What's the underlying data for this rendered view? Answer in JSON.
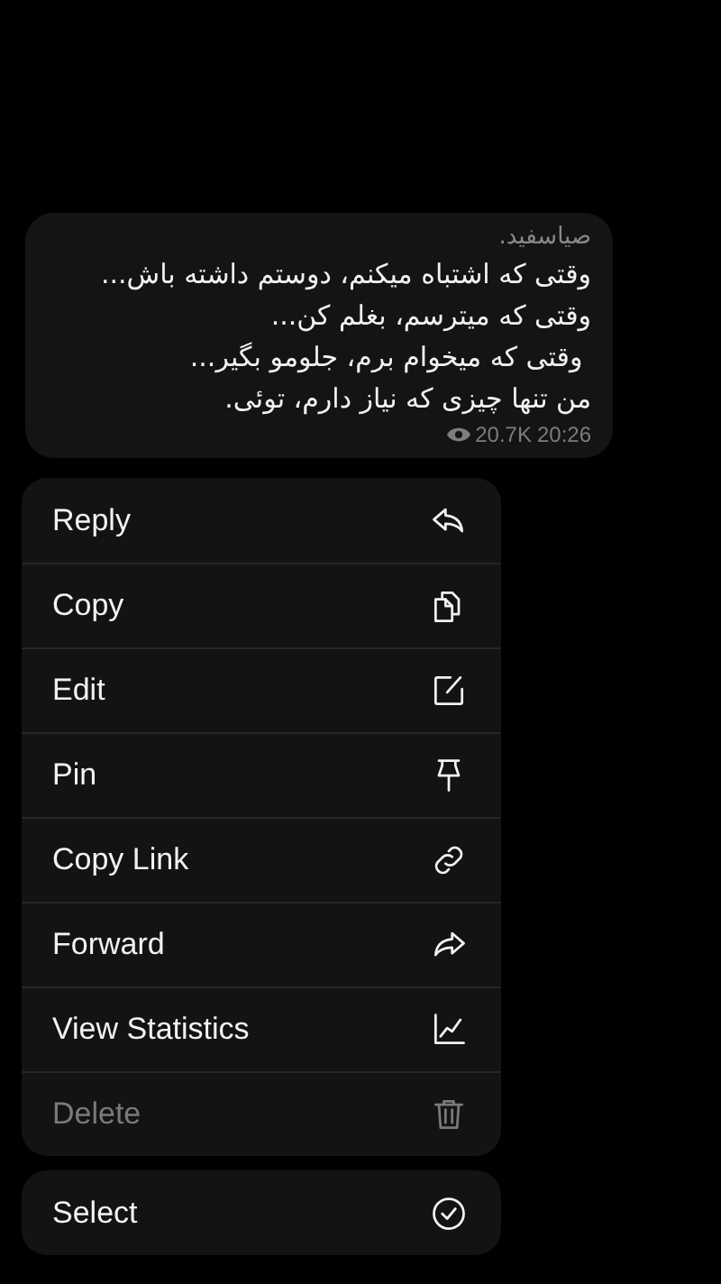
{
  "message": {
    "author": "صیاسفید.",
    "lines": [
      "وقتی که اشتباه میکنم، دوستم داشته باش...",
      "وقتی که میترسم، بغلم کن...",
      " وقتی که میخوام برم، جلومو بگیر...",
      "من تنها چیزی که نیاز دارم، توئی."
    ],
    "views": "20.7K",
    "time": "20:26"
  },
  "menu": {
    "groups": [
      {
        "items": [
          {
            "label": "Reply",
            "kind": "reply",
            "disabled": false
          },
          {
            "label": "Copy",
            "kind": "copy",
            "disabled": false
          },
          {
            "label": "Edit",
            "kind": "edit",
            "disabled": false
          },
          {
            "label": "Pin",
            "kind": "pin",
            "disabled": false
          },
          {
            "label": "Copy Link",
            "kind": "link",
            "disabled": false
          },
          {
            "label": "Forward",
            "kind": "forward",
            "disabled": false
          },
          {
            "label": "View Statistics",
            "kind": "stats",
            "disabled": false
          },
          {
            "label": "Delete",
            "kind": "delete",
            "disabled": true
          }
        ]
      },
      {
        "items": [
          {
            "label": "Select",
            "kind": "select",
            "disabled": false
          }
        ]
      }
    ]
  }
}
